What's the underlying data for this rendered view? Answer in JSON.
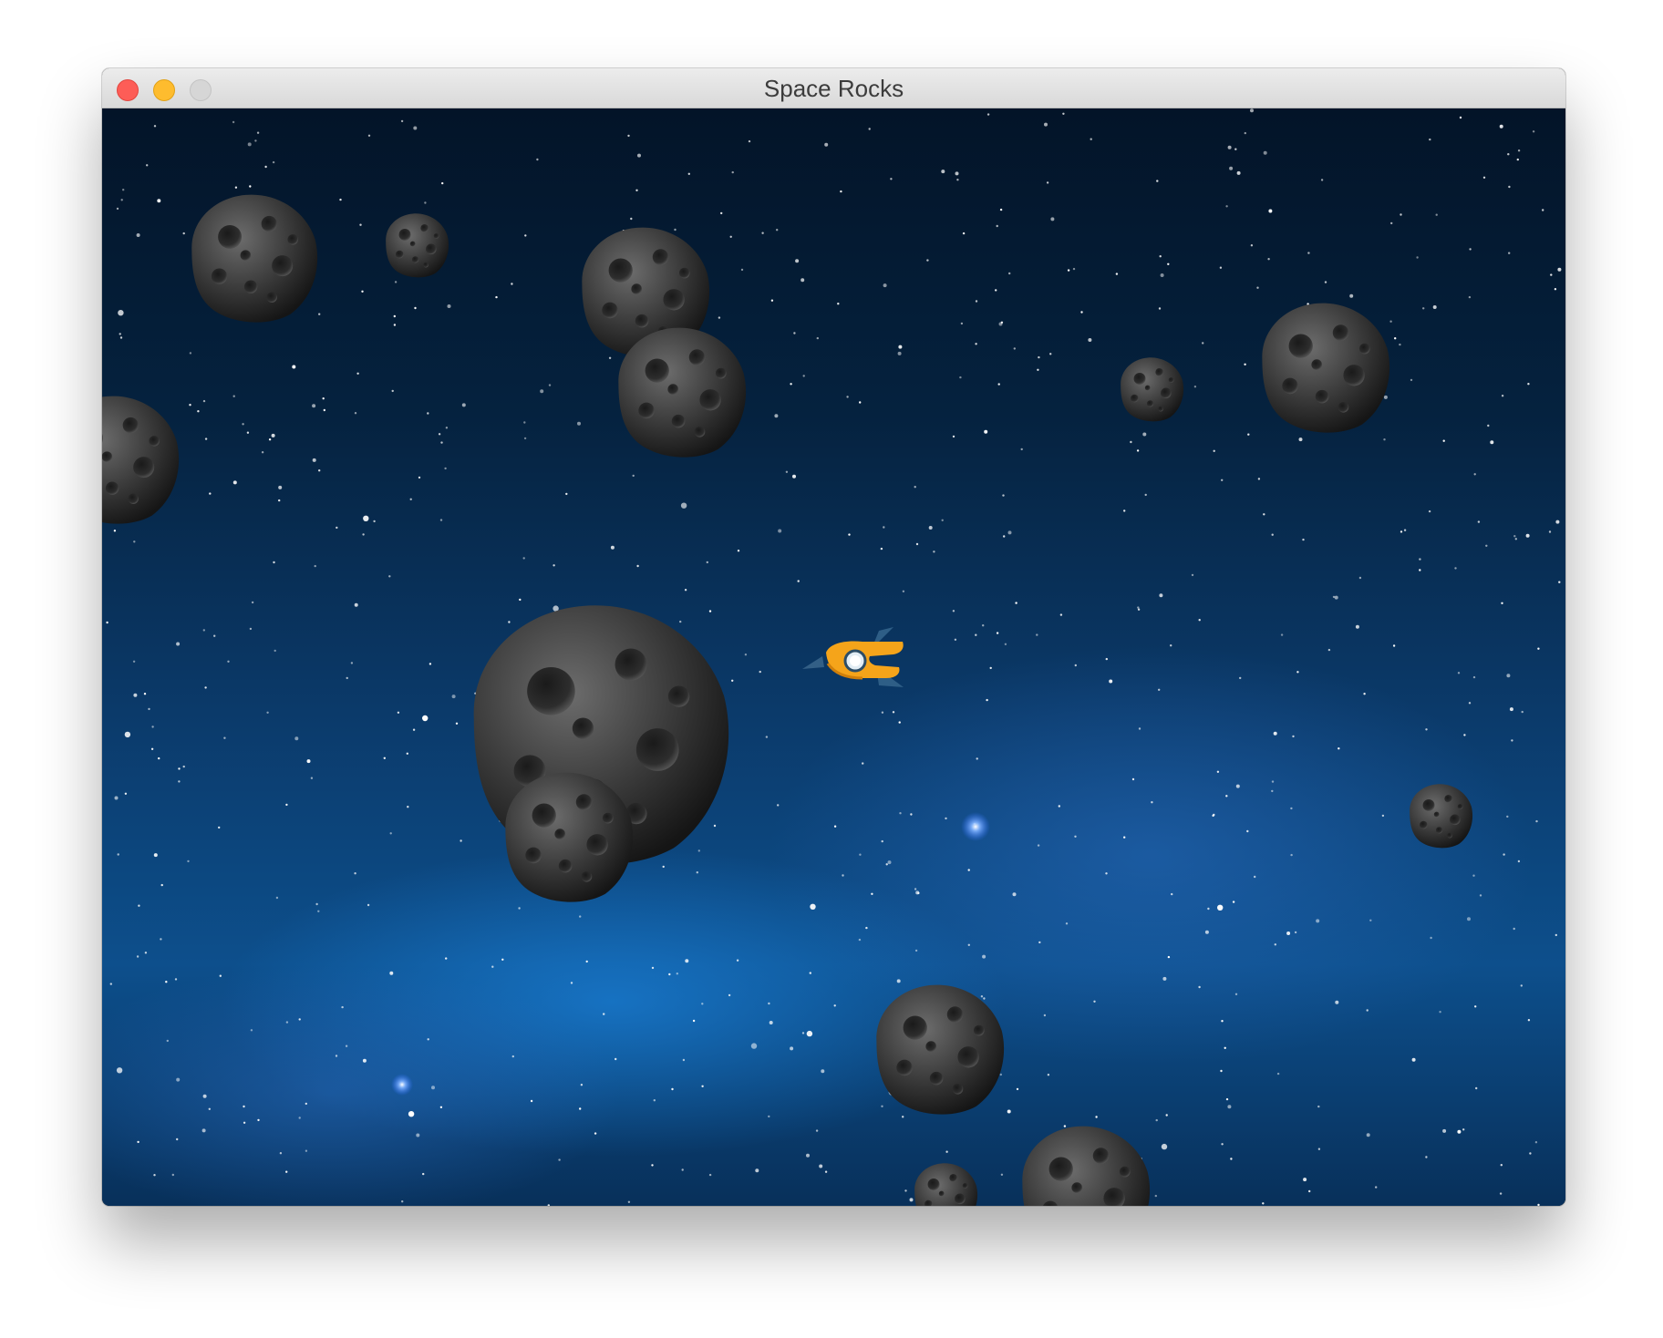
{
  "window": {
    "title": "Space Rocks",
    "controls": {
      "close_color": "#fd5d57",
      "minimize_color": "#febc2e",
      "zoom_color": "#d6d6d6"
    }
  },
  "game": {
    "background": "starfield-nebula",
    "sprites": {
      "player": "spaceship",
      "enemies": "asteroid"
    }
  }
}
